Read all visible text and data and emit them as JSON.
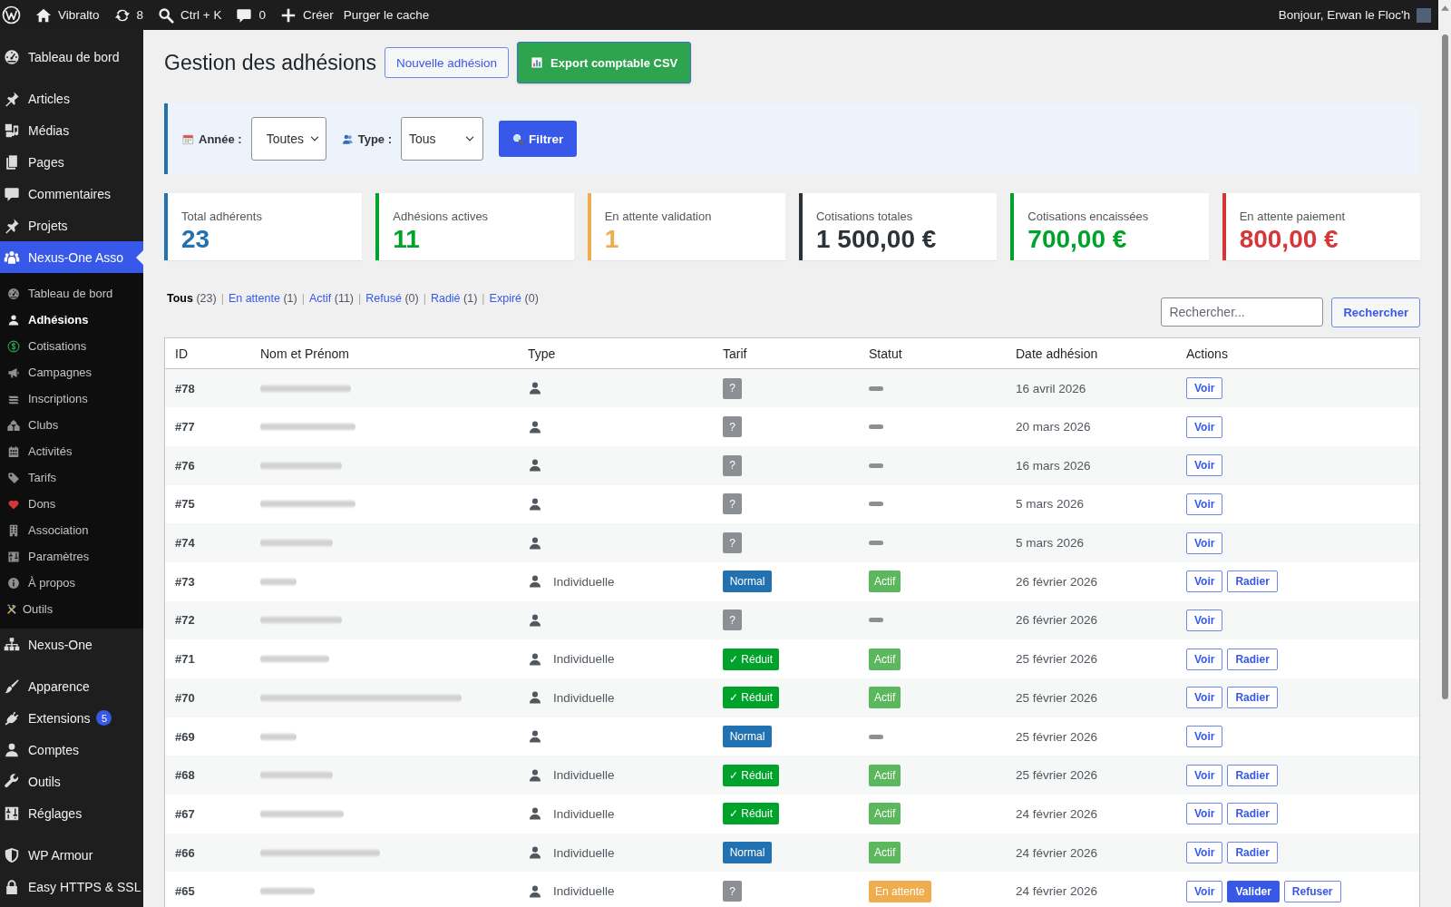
{
  "admin_bar": {
    "items": [
      {
        "label": "Vibralto"
      },
      {
        "label": "8"
      },
      {
        "label": "Ctrl + K"
      },
      {
        "label": "0"
      },
      {
        "label": "Créer"
      },
      {
        "label": "Purger le cache"
      }
    ],
    "greeting": "Bonjour, Erwan le Floc'h"
  },
  "sidebar": {
    "groups": [
      {
        "items": [
          {
            "label": "Tableau de bord",
            "selected": false
          }
        ]
      },
      {
        "items": [
          {
            "label": "Articles",
            "selected": false
          },
          {
            "label": "Médias",
            "selected": false
          },
          {
            "label": "Pages",
            "selected": false
          },
          {
            "label": "Commentaires",
            "selected": false
          },
          {
            "label": "Projets",
            "selected": false
          },
          {
            "label": "Nexus-One Asso",
            "selected": true,
            "children": [
              {
                "label": "Tableau de bord",
                "selected": false
              },
              {
                "label": "Adhésions",
                "selected": true
              },
              {
                "label": "Cotisations",
                "selected": false
              },
              {
                "label": "Campagnes",
                "selected": false
              },
              {
                "label": "Inscriptions",
                "selected": false
              },
              {
                "label": "Clubs",
                "selected": false
              },
              {
                "label": "Activités",
                "selected": false
              },
              {
                "label": "Tarifs",
                "selected": false
              },
              {
                "label": "Dons",
                "selected": false
              },
              {
                "label": "Association",
                "selected": false
              },
              {
                "label": "Paramètres",
                "selected": false
              },
              {
                "label": "À propos",
                "selected": false
              },
              {
                "label": "Outils",
                "selected": false
              }
            ]
          },
          {
            "label": "Nexus-One",
            "selected": false
          }
        ]
      },
      {
        "items": [
          {
            "label": "Apparence",
            "selected": false
          },
          {
            "label": "Extensions",
            "selected": false,
            "badge": "5"
          },
          {
            "label": "Comptes",
            "selected": false
          },
          {
            "label": "Outils",
            "selected": false
          },
          {
            "label": "Réglages",
            "selected": false
          }
        ]
      },
      {
        "items": [
          {
            "label": "WP Armour",
            "selected": false
          },
          {
            "label": "Easy HTTPS & SSL",
            "selected": false
          }
        ]
      }
    ]
  },
  "page": {
    "title": "Gestion des adhésions",
    "buttons": [
      {
        "label": "Nouvelle adhésion",
        "kind": "outline"
      },
      {
        "label": "Export comptable CSV",
        "kind": "success"
      }
    ]
  },
  "filters": {
    "fields": [
      {
        "label": "Année :",
        "value": "Toutes"
      },
      {
        "label": "Type :",
        "value": "Tous"
      }
    ],
    "submit": "Filtrer"
  },
  "stats": [
    {
      "label": "Total adhérents",
      "value": "23",
      "color": "#2271b1"
    },
    {
      "label": "Adhésions actives",
      "value": "11",
      "color": "#00a32a"
    },
    {
      "label": "En attente validation",
      "value": "1",
      "color": "#f0ad4e"
    },
    {
      "label": "Cotisations totales",
      "value": "1 500,00 €",
      "color": "#2c3338"
    },
    {
      "label": "Cotisations encaissées",
      "value": "700,00 €",
      "color": "#00a32a"
    },
    {
      "label": "En attente paiement",
      "value": "800,00 €",
      "color": "#d63638"
    }
  ],
  "status_filters": [
    {
      "label": "Tous",
      "count": "(23)",
      "selected": true,
      "separator": "|"
    },
    {
      "label": "En attente",
      "count": "(1)",
      "selected": false,
      "separator": "|"
    },
    {
      "label": "Actif",
      "count": "(11)",
      "selected": false,
      "separator": "|"
    },
    {
      "label": "Refusé",
      "count": "(0)",
      "selected": false,
      "separator": "|"
    },
    {
      "label": "Radié",
      "count": "(1)",
      "selected": false,
      "separator": "|"
    },
    {
      "label": "Expiré",
      "count": "(0)",
      "selected": false
    }
  ],
  "search": {
    "placeholder": "Rechercher...",
    "button": "Rechercher"
  },
  "table": {
    "columns": [
      "ID",
      "Nom et Prénom",
      "Type",
      "Tarif",
      "Statut",
      "Date adhésion",
      "Actions"
    ],
    "rows": [
      {
        "id": "#78",
        "name_blurred": true,
        "tarif": {
          "kind": "unknown",
          "label": "?"
        },
        "status": {
          "kind": "none"
        },
        "date": "16 avril 2026",
        "actions": [
          {
            "label": "Voir",
            "kind": "outline"
          }
        ]
      },
      {
        "id": "#77",
        "name_blurred": true,
        "tarif": {
          "kind": "unknown",
          "label": "?"
        },
        "status": {
          "kind": "none"
        },
        "date": "20 mars 2026",
        "actions": [
          {
            "label": "Voir",
            "kind": "outline"
          }
        ]
      },
      {
        "id": "#76",
        "name_blurred": true,
        "tarif": {
          "kind": "unknown",
          "label": "?"
        },
        "status": {
          "kind": "none"
        },
        "date": "16 mars 2026",
        "actions": [
          {
            "label": "Voir",
            "kind": "outline"
          }
        ]
      },
      {
        "id": "#75",
        "name_blurred": true,
        "tarif": {
          "kind": "unknown",
          "label": "?"
        },
        "status": {
          "kind": "none"
        },
        "date": "5 mars 2026",
        "actions": [
          {
            "label": "Voir",
            "kind": "outline"
          }
        ]
      },
      {
        "id": "#74",
        "name_blurred": true,
        "tarif": {
          "kind": "unknown",
          "label": "?"
        },
        "status": {
          "kind": "none"
        },
        "date": "5 mars 2026",
        "actions": [
          {
            "label": "Voir",
            "kind": "outline"
          }
        ]
      },
      {
        "id": "#73",
        "name_blurred": true,
        "type": "Individuelle",
        "tarif": {
          "kind": "normal",
          "label": "Normal"
        },
        "status": {
          "kind": "active",
          "label": "Actif"
        },
        "date": "26 février 2026",
        "actions": [
          {
            "label": "Voir",
            "kind": "outline"
          },
          {
            "label": "Radier",
            "kind": "outline"
          }
        ]
      },
      {
        "id": "#72",
        "name_blurred": true,
        "tarif": {
          "kind": "unknown",
          "label": "?"
        },
        "status": {
          "kind": "none"
        },
        "date": "26 février 2026",
        "actions": [
          {
            "label": "Voir",
            "kind": "outline"
          }
        ]
      },
      {
        "id": "#71",
        "name_blurred": true,
        "type": "Individuelle",
        "tarif": {
          "kind": "reduced",
          "label": "✓ Réduit"
        },
        "status": {
          "kind": "active",
          "label": "Actif"
        },
        "date": "25 février 2026",
        "actions": [
          {
            "label": "Voir",
            "kind": "outline"
          },
          {
            "label": "Radier",
            "kind": "outline"
          }
        ]
      },
      {
        "id": "#70",
        "name_blurred": true,
        "type": "Individuelle",
        "tarif": {
          "kind": "reduced",
          "label": "✓ Réduit"
        },
        "status": {
          "kind": "active",
          "label": "Actif"
        },
        "date": "25 février 2026",
        "actions": [
          {
            "label": "Voir",
            "kind": "outline"
          },
          {
            "label": "Radier",
            "kind": "outline"
          }
        ]
      },
      {
        "id": "#69",
        "name_blurred": true,
        "tarif": {
          "kind": "normal",
          "label": "Normal"
        },
        "status": {
          "kind": "none"
        },
        "date": "25 février 2026",
        "actions": [
          {
            "label": "Voir",
            "kind": "outline"
          }
        ]
      },
      {
        "id": "#68",
        "name_blurred": true,
        "type": "Individuelle",
        "tarif": {
          "kind": "reduced",
          "label": "✓ Réduit"
        },
        "status": {
          "kind": "active",
          "label": "Actif"
        },
        "date": "25 février 2026",
        "actions": [
          {
            "label": "Voir",
            "kind": "outline"
          },
          {
            "label": "Radier",
            "kind": "outline"
          }
        ]
      },
      {
        "id": "#67",
        "name_blurred": true,
        "type": "Individuelle",
        "tarif": {
          "kind": "reduced",
          "label": "✓ Réduit"
        },
        "status": {
          "kind": "active",
          "label": "Actif"
        },
        "date": "24 février 2026",
        "actions": [
          {
            "label": "Voir",
            "kind": "outline"
          },
          {
            "label": "Radier",
            "kind": "outline"
          }
        ]
      },
      {
        "id": "#66",
        "name_blurred": true,
        "type": "Individuelle",
        "tarif": {
          "kind": "normal",
          "label": "Normal"
        },
        "status": {
          "kind": "active",
          "label": "Actif"
        },
        "date": "24 février 2026",
        "actions": [
          {
            "label": "Voir",
            "kind": "outline"
          },
          {
            "label": "Radier",
            "kind": "outline"
          }
        ]
      },
      {
        "id": "#65",
        "name_blurred": true,
        "type": "Individuelle",
        "tarif": {
          "kind": "unknown",
          "label": "?"
        },
        "status": {
          "kind": "pending",
          "label": "En attente"
        },
        "date": "24 février 2026",
        "actions": [
          {
            "label": "Voir",
            "kind": "outline"
          },
          {
            "label": "Valider",
            "kind": "primary"
          },
          {
            "label": "Refuser",
            "kind": "outline"
          }
        ]
      }
    ]
  }
}
